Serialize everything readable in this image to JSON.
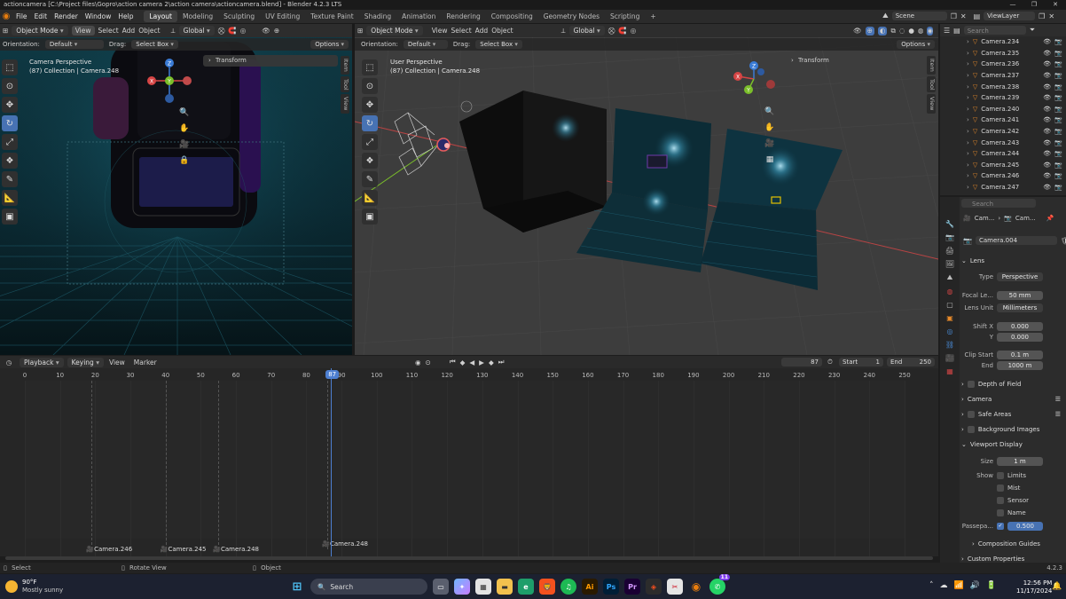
{
  "window": {
    "title": "actioncamera [C:\\Project files\\Gopro\\action camera 2\\action camera\\actioncamera.blend] - Blender 4.2.3 LTS",
    "controls": [
      "—",
      "❐",
      "✕"
    ]
  },
  "menu": [
    "File",
    "Edit",
    "Render",
    "Window",
    "Help"
  ],
  "workspaces": [
    "Layout",
    "Modeling",
    "Sculpting",
    "UV Editing",
    "Texture Paint",
    "Shading",
    "Animation",
    "Rendering",
    "Compositing",
    "Geometry Nodes",
    "Scripting"
  ],
  "active_workspace": "Layout",
  "scene": "Scene",
  "view_layer": "ViewLayer",
  "left_viewport": {
    "mode": "Object Mode",
    "menu": [
      "View",
      "Select",
      "Add",
      "Object"
    ],
    "transform_orientation": "Global",
    "orientation_label": "Orientation:",
    "orientation_value": "Default",
    "drag_label": "Drag:",
    "drag_value": "Select Box",
    "options": "Options",
    "overlay_line1": "Camera Perspective",
    "overlay_line2": "(87) Collection | Camera.248",
    "transform_panel": "Transform",
    "side_tabs": [
      "Item",
      "Tool",
      "View"
    ]
  },
  "right_viewport": {
    "mode": "Object Mode",
    "menu": [
      "View",
      "Select",
      "Add",
      "Object"
    ],
    "transform_orientation": "Global",
    "orientation_label": "Orientation:",
    "orientation_value": "Default",
    "drag_label": "Drag:",
    "drag_value": "Select Box",
    "options": "Options",
    "overlay_line1": "User Perspective",
    "overlay_line2": "(87) Collection | Camera.248",
    "transform_panel": "Transform",
    "side_tabs": [
      "Item",
      "Tool",
      "View"
    ]
  },
  "gizmo_axes": {
    "x": "X",
    "y": "Y",
    "z": "Z"
  },
  "timeline": {
    "menu": [
      "Playback",
      "Keying",
      "View",
      "Marker"
    ],
    "current_frame": "87",
    "start_label": "Start",
    "start": "1",
    "end_label": "End",
    "end": "250",
    "ticks": [
      "0",
      "10",
      "20",
      "30",
      "40",
      "50",
      "60",
      "70",
      "80",
      "90",
      "100",
      "110",
      "120",
      "130",
      "140",
      "150",
      "160",
      "170",
      "180",
      "190",
      "200",
      "210",
      "220",
      "230",
      "240",
      "250"
    ],
    "markers": [
      "Camera.246",
      "Camera.245",
      "Camera.248",
      "Camera.248"
    ]
  },
  "status_bar": {
    "select": "Select",
    "rotate": "Rotate View",
    "object": "Object",
    "version": "4.2.3"
  },
  "outliner": {
    "search_placeholder": "Search",
    "items": [
      "Camera.234",
      "Camera.235",
      "Camera.236",
      "Camera.237",
      "Camera.238",
      "Camera.239",
      "Camera.240",
      "Camera.241",
      "Camera.242",
      "Camera.243",
      "Camera.244",
      "Camera.245",
      "Camera.246",
      "Camera.247",
      "Camera.248"
    ]
  },
  "properties": {
    "search_placeholder": "Search",
    "breadcrumb": [
      "Cam...",
      "Cam..."
    ],
    "datablock": "Camera.004",
    "lens_section": "Lens",
    "type_label": "Type",
    "type_value": "Perspective",
    "focal_label": "Focal Le...",
    "focal_value": "50 mm",
    "lens_unit_label": "Lens Unit",
    "lens_unit_value": "Millimeters",
    "shift_x_label": "Shift X",
    "shift_x_value": "0.000",
    "shift_y_label": "Y",
    "shift_y_value": "0.000",
    "clip_start_label": "Clip Start",
    "clip_start_value": "0.1 m",
    "clip_end_label": "End",
    "clip_end_value": "1000 m",
    "dof_section": "Depth of Field",
    "camera_section": "Camera",
    "safe_areas_section": "Safe Areas",
    "bg_images_section": "Background Images",
    "viewport_display_section": "Viewport Display",
    "size_label": "Size",
    "size_value": "1 m",
    "show_label": "Show",
    "show_limits": "Limits",
    "show_mist": "Mist",
    "show_sensor": "Sensor",
    "show_name": "Name",
    "passepartout_label": "Passepa...",
    "passepartout_value": "0.500",
    "composition_guides": "Composition Guides",
    "custom_properties": "Custom Properties"
  },
  "taskbar": {
    "weather_temp": "90°F",
    "weather_desc": "Mostly sunny",
    "search_placeholder": "Search",
    "time": "12:56 PM",
    "date": "11/17/2024",
    "whatsapp_badge": "11",
    "apps": [
      "windows-start",
      "search",
      "file-explorer",
      "copilot",
      "store",
      "folder",
      "edge",
      "brave",
      "spotify",
      "illustrator",
      "photoshop",
      "premiere",
      "figma",
      "snipping",
      "blender",
      "whatsapp"
    ]
  },
  "colors": {
    "accent": "#4772b3",
    "playhead": "#4d7fd1",
    "x_axis": "#d64545",
    "y_axis": "#7bbf2a",
    "z_axis": "#3a7bd5"
  }
}
